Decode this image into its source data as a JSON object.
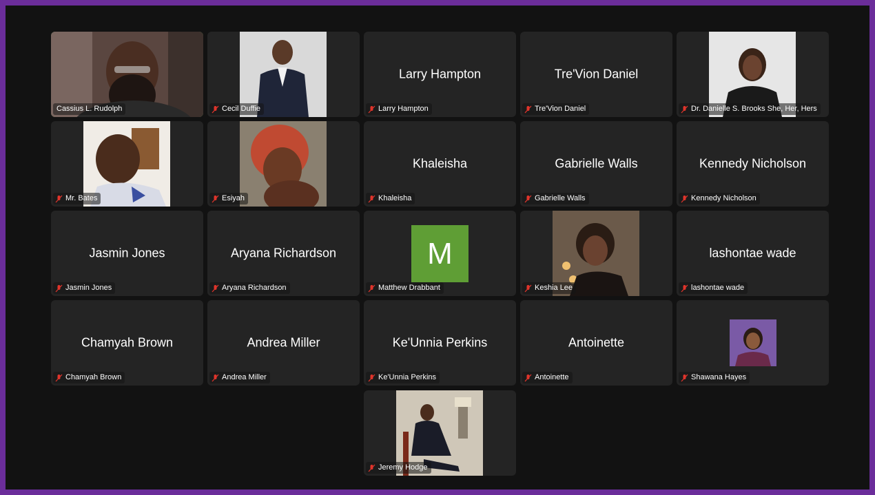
{
  "participants": [
    {
      "name": "Cassius L. Rudolph",
      "display": "",
      "muted": false,
      "active": true,
      "avatar": "camera-video"
    },
    {
      "name": "Cecil Duffie",
      "display": "",
      "muted": true,
      "avatar": "photo"
    },
    {
      "name": "Larry Hampton",
      "display": "Larry Hampton",
      "muted": true
    },
    {
      "name": "Tre'Vion Daniel",
      "display": "Tre'Vion Daniel",
      "muted": true
    },
    {
      "name": "Dr. Danielle S. Brooks She, Her, Hers",
      "display": "",
      "muted": true,
      "avatar": "photo"
    },
    {
      "name": "Mr. Bates",
      "display": "",
      "muted": true,
      "avatar": "photo"
    },
    {
      "name": "Esiyah",
      "display": "",
      "muted": true,
      "avatar": "photo"
    },
    {
      "name": "Khaleisha",
      "display": "Khaleisha",
      "muted": true
    },
    {
      "name": "Gabrielle Walls",
      "display": "Gabrielle Walls",
      "muted": true
    },
    {
      "name": "Kennedy Nicholson",
      "display": "Kennedy Nicholson",
      "muted": true
    },
    {
      "name": "Jasmin Jones",
      "display": "Jasmin Jones",
      "muted": true
    },
    {
      "name": "Aryana Richardson",
      "display": "Aryana Richardson",
      "muted": true
    },
    {
      "name": "Matthew Drabbant",
      "display": "",
      "muted": true,
      "avatar": "initial",
      "initial": "M",
      "initial_color": "#5f9e35"
    },
    {
      "name": "Keshia Lee",
      "display": "",
      "muted": true,
      "avatar": "photo"
    },
    {
      "name": "lashontae wade",
      "display": "lashontae wade",
      "muted": true
    },
    {
      "name": "Chamyah Brown",
      "display": "Chamyah Brown",
      "muted": true
    },
    {
      "name": "Andrea Miller",
      "display": "Andrea Miller",
      "muted": true
    },
    {
      "name": "Ke'Unnia Perkins",
      "display": "Ke'Unnia Perkins",
      "muted": true
    },
    {
      "name": "Antoinette",
      "display": "Antoinette",
      "muted": true
    },
    {
      "name": "Shawana Hayes",
      "display": "",
      "muted": true,
      "avatar": "small-photo"
    },
    {
      "name": "Jeremy Hodge",
      "display": "",
      "muted": true,
      "avatar": "photo"
    }
  ],
  "icons": {
    "muted": "mic-muted-icon"
  },
  "colors": {
    "frame": "#6b2d9a",
    "background": "#121212",
    "tile": "#242424",
    "active_border": "#3ccf4e",
    "muted_icon": "#e0342b"
  }
}
